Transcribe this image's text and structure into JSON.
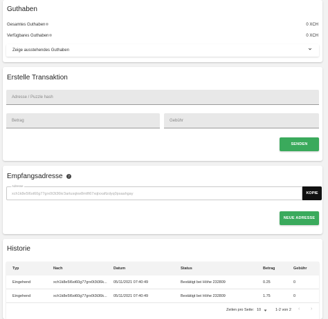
{
  "balance": {
    "title": "Guthaben",
    "total_label": "Gesamtes Guthaben",
    "total_value": "0 XCH",
    "spendable_label": "Verfügbares Guthaben",
    "spendable_value": "0 XCH",
    "pending_label": "Zeige ausstehendes Guthaben"
  },
  "transaction": {
    "title": "Erstelle Transaktion",
    "address_placeholder": "Adresse / Puzzle hash",
    "amount_placeholder": "Betrag",
    "fee_placeholder": "Gebühr",
    "send_label": "SENDEN"
  },
  "receive": {
    "title": "Empfangsadresse",
    "field_label": "Adresse",
    "address": "xch1k8e5l6st60g77grx0t3t36kr3artusqkw8mtft67xqlxxaftzdyq0psaahgay",
    "copy_label": "KOPIE",
    "new_address_label": "NEUE ADRESSE"
  },
  "history": {
    "title": "Historie",
    "columns": [
      "Typ",
      "Nach",
      "Datum",
      "Status",
      "Betrag",
      "Gebühr"
    ],
    "rows": [
      {
        "type": "Eingehend",
        "to": "xch1k8e5l6st60g77grx0t3t36k...",
        "date": "05/11/2021 07:40:49",
        "status": "Bestätigt bei Höhe 232809",
        "amount": "0.25",
        "fee": "0"
      },
      {
        "type": "Eingehend",
        "to": "xch1k8e5l6st60g77grx0t3t36k...",
        "date": "05/11/2021 07:40:49",
        "status": "Bestätigt bei Höhe 232809",
        "amount": "1.75",
        "fee": "0"
      }
    ],
    "rows_per_page_label": "Zeilen pro Seite:",
    "rows_per_page_value": "10",
    "range_label": "1-2 von 2"
  },
  "colors": {
    "accent": "#3aaa5c",
    "copy_button": "#111111",
    "background": "#f2f2f2"
  },
  "icons": [
    "help-icon",
    "chevron-down-icon",
    "question-icon",
    "dropdown-arrow-icon",
    "chevron-left-icon",
    "chevron-right-icon"
  ]
}
